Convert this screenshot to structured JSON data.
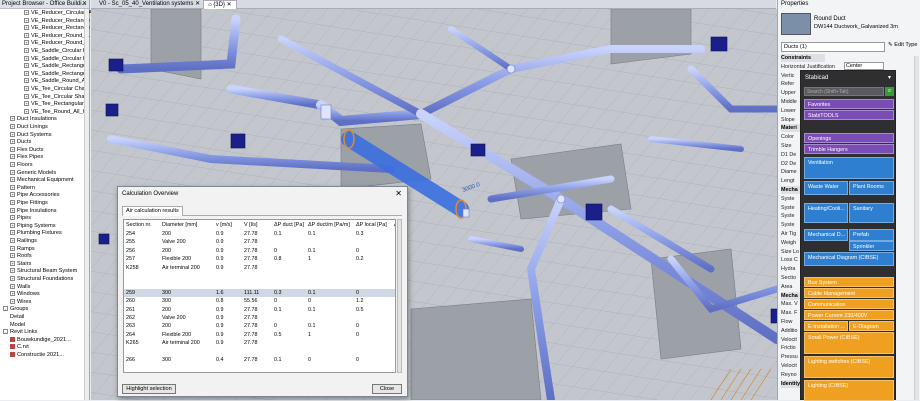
{
  "project_browser": {
    "title": "Project Browser - Office Buildi...",
    "items": [
      {
        "label": "VE_Reducer_Circular_A",
        "indent": 3,
        "toggle": "+"
      },
      {
        "label": "VE_Reducer_Rectangu",
        "indent": 3,
        "toggle": "+"
      },
      {
        "label": "VE_Reducer_Rectangu",
        "indent": 3,
        "toggle": "+"
      },
      {
        "label": "VE_Reducer_Round_...",
        "indent": 3,
        "toggle": "+"
      },
      {
        "label": "VE_Reducer_Round_",
        "indent": 3,
        "toggle": "+"
      },
      {
        "label": "VE_Saddle_Circular F",
        "indent": 3,
        "toggle": "+"
      },
      {
        "label": "VE_Saddle_Circular F",
        "indent": 3,
        "toggle": "+"
      },
      {
        "label": "VE_Saddle_Rectangu",
        "indent": 3,
        "toggle": "+"
      },
      {
        "label": "VE_Saddle_Rectangu",
        "indent": 3,
        "toggle": "+"
      },
      {
        "label": "VE_Saddle_Round_A",
        "indent": 3,
        "toggle": "+"
      },
      {
        "label": "VE_Tee_Circular Char",
        "indent": 3,
        "toggle": "+"
      },
      {
        "label": "VE_Tee_Circular Shar",
        "indent": 3,
        "toggle": "+"
      },
      {
        "label": "VE_Tee_Rectangular_",
        "indent": 3,
        "toggle": "+"
      },
      {
        "label": "VE_Tee_Round_All_G",
        "indent": 3,
        "toggle": "+"
      },
      {
        "label": "Duct Insulations",
        "indent": 1,
        "toggle": "+"
      },
      {
        "label": "Duct Linings",
        "indent": 1,
        "toggle": "+"
      },
      {
        "label": "Duct Systems",
        "indent": 1,
        "toggle": "+"
      },
      {
        "label": "Ducts",
        "indent": 1,
        "toggle": "+"
      },
      {
        "label": "Flex Ducts",
        "indent": 1,
        "toggle": "+"
      },
      {
        "label": "Flex Pipes",
        "indent": 1,
        "toggle": "+"
      },
      {
        "label": "Floors",
        "indent": 1,
        "toggle": "+"
      },
      {
        "label": "Generic Models",
        "indent": 1,
        "toggle": "+"
      },
      {
        "label": "Mechanical Equipment",
        "indent": 1,
        "toggle": "+"
      },
      {
        "label": "Pattern",
        "indent": 1,
        "toggle": "+"
      },
      {
        "label": "Pipe Accessories",
        "indent": 1,
        "toggle": "+"
      },
      {
        "label": "Pipe Fittings",
        "indent": 1,
        "toggle": "+"
      },
      {
        "label": "Pipe Insulations",
        "indent": 1,
        "toggle": "+"
      },
      {
        "label": "Pipes",
        "indent": 1,
        "toggle": "+"
      },
      {
        "label": "Piping Systems",
        "indent": 1,
        "toggle": "+"
      },
      {
        "label": "Plumbing Fixtures",
        "indent": 1,
        "toggle": "+"
      },
      {
        "label": "Railings",
        "indent": 1,
        "toggle": "+"
      },
      {
        "label": "Ramps",
        "indent": 1,
        "toggle": "+"
      },
      {
        "label": "Roofs",
        "indent": 1,
        "toggle": "+"
      },
      {
        "label": "Stairs",
        "indent": 1,
        "toggle": "+"
      },
      {
        "label": "Structural Beam System",
        "indent": 1,
        "toggle": "+"
      },
      {
        "label": "Structural Foundations",
        "indent": 1,
        "toggle": "+"
      },
      {
        "label": "Walls",
        "indent": 1,
        "toggle": "+"
      },
      {
        "label": "Windows",
        "indent": 1,
        "toggle": "+"
      },
      {
        "label": "Wires",
        "indent": 1,
        "toggle": "+"
      },
      {
        "label": "Groups",
        "indent": 0,
        "toggle": "-"
      },
      {
        "label": "Detail",
        "indent": 1,
        "toggle": ""
      },
      {
        "label": "Model",
        "indent": 1,
        "toggle": ""
      },
      {
        "label": "Revit Links",
        "indent": 0,
        "toggle": "-"
      },
      {
        "label": "Bouwkundige_2021...",
        "indent": 1,
        "toggle": "",
        "icon": true
      },
      {
        "label": "C.rvt",
        "indent": 1,
        "toggle": "",
        "icon": true
      },
      {
        "label": "Constructie 2021...",
        "indent": 1,
        "toggle": "",
        "icon": true
      }
    ]
  },
  "tabs": [
    {
      "label": "V0 - Sc_05_40_Ventilation systems",
      "active": false
    },
    {
      "label": "{3D}",
      "active": true
    }
  ],
  "viewport": {
    "duct_label": "3000.0",
    "colors": {
      "duct": "#8c9ee6",
      "duct_selected": "#3b6fe0",
      "equipment": "#1b1f8a",
      "grid": "#b7bcc4",
      "wall": "#9ea3aa"
    }
  },
  "properties": {
    "title": "Properties",
    "family": "Round Duct",
    "type": "DW144 Ductwork_Galvanized 3m",
    "selector": "Ducts (1)",
    "edit_type": "Edit Type",
    "rows": [
      {
        "label": "Constraints",
        "section": true
      },
      {
        "label": "Horizontal Justification",
        "value": "Center"
      },
      {
        "label": "Vertic"
      },
      {
        "label": "Refer"
      },
      {
        "label": "Upper"
      },
      {
        "label": "Middle"
      },
      {
        "label": "Lower"
      },
      {
        "label": "Slope"
      },
      {
        "label": "Materi",
        "section": true
      },
      {
        "label": "Color"
      },
      {
        "label": "Size"
      },
      {
        "label": "D1 De"
      },
      {
        "label": "D2 De"
      },
      {
        "label": "Diame"
      },
      {
        "label": "Lengt"
      },
      {
        "label": "Mecha",
        "section": true
      },
      {
        "label": "Syste"
      },
      {
        "label": "Syste"
      },
      {
        "label": "Syste"
      },
      {
        "label": "Syste"
      },
      {
        "label": "Air Tig"
      },
      {
        "label": "Weigh"
      },
      {
        "label": "Size Lo"
      },
      {
        "label": "Loss C"
      },
      {
        "label": "Hydra"
      },
      {
        "label": "Sectio"
      },
      {
        "label": "Area"
      },
      {
        "label": "Mecha",
        "section": true
      },
      {
        "label": "Max. V"
      },
      {
        "label": "Max. F"
      },
      {
        "label": "Flow"
      },
      {
        "label": "Additio"
      },
      {
        "label": "Velocit"
      },
      {
        "label": "Frictio"
      },
      {
        "label": "Pressu"
      },
      {
        "label": "Velocit"
      },
      {
        "label": "Reyno"
      },
      {
        "label": "Identity",
        "section": true
      }
    ]
  },
  "stabicad": {
    "title": "Stabicad",
    "search_placeholder": "Search (Shift+Tab)",
    "buttons": [
      {
        "label": "Favorites",
        "color": "#7a4db5"
      },
      {
        "label": "StabiTOOLS",
        "color": "#7a4db5"
      },
      {
        "label": "Openings",
        "color": "#7a4db5"
      },
      {
        "label": "Trimble Hangers",
        "color": "#7a4db5"
      },
      {
        "label": "Ventilation",
        "color": "#2f7fd0"
      },
      {
        "label": "Waste Water",
        "color": "#2f7fd0"
      },
      {
        "label": "Plant Rooms",
        "color": "#2f7fd0"
      },
      {
        "label": "Heating/Cooli...",
        "color": "#2f7fd0"
      },
      {
        "label": "Sanitary",
        "color": "#2f7fd0"
      },
      {
        "label": "Mechanical D...",
        "color": "#2f7fd0"
      },
      {
        "label": "Prefab",
        "color": "#2f7fd0"
      },
      {
        "label": "Sprinkler",
        "color": "#2f7fd0"
      },
      {
        "label": "Mechanical Diagram (CIBSE)",
        "color": "#2f7fd0"
      },
      {
        "label": "Bus System",
        "color": "#f0a020"
      },
      {
        "label": "Cable Management",
        "color": "#f0a020"
      },
      {
        "label": "Communication",
        "color": "#f0a020"
      },
      {
        "label": "Power Current 230/400V",
        "color": "#f0a020"
      },
      {
        "label": "E-Installation ...",
        "color": "#f0a020"
      },
      {
        "label": "E-Diagram",
        "color": "#f0a020"
      },
      {
        "label": "Small Power (CIBSE)",
        "color": "#f0a020"
      },
      {
        "label": "Lighting switches (CIBSE)",
        "color": "#f0a020"
      },
      {
        "label": "Lighting (CIBSE)",
        "color": "#f0a020"
      }
    ]
  },
  "dialog": {
    "title": "Calculation Overview",
    "tab": "Air calculation results",
    "headers": [
      "Section nr.",
      "Diameter [mm]",
      "v [m/s]",
      "V [l/s]",
      "ΔP duct [Pa]",
      "ΔP duct/m [Pa/m]",
      "ΔP local [Pa]",
      "ΔP"
    ],
    "rows": [
      [
        "254",
        "200",
        "0.9",
        "27.78",
        "0.1",
        "0.1",
        "0.3",
        ""
      ],
      [
        "255",
        "Valve 200",
        "0.9",
        "27.78",
        "",
        "",
        "",
        ""
      ],
      [
        "256",
        "200",
        "0.9",
        "27.78",
        "0",
        "0.1",
        "0",
        ""
      ],
      [
        "257",
        "Flexible 200",
        "0.9",
        "27.78",
        "0.8",
        "1",
        "0.2",
        ""
      ],
      [
        "K258",
        "Air terminal 200",
        "0.9",
        "27.78",
        "",
        "",
        "",
        ""
      ],
      [
        "",
        "",
        "",
        "",
        "",
        "",
        "",
        ""
      ],
      [
        "",
        "",
        "",
        "",
        "",
        "",
        "",
        ""
      ],
      [
        "259",
        "300",
        "1.6",
        "111.11",
        "0.3",
        "0.1",
        "0",
        ""
      ],
      [
        "260",
        "300",
        "0.8",
        "55.56",
        "0",
        "0",
        "1.2",
        ""
      ],
      [
        "261",
        "200",
        "0.9",
        "27.78",
        "0.1",
        "0.1",
        "0.5",
        ""
      ],
      [
        "262",
        "Valve 200",
        "0.9",
        "27.78",
        "",
        "",
        "",
        ""
      ],
      [
        "263",
        "200",
        "0.9",
        "27.78",
        "0",
        "0.1",
        "0",
        ""
      ],
      [
        "264",
        "Flexible 200",
        "0.9",
        "27.78",
        "0.5",
        "1",
        "0",
        ""
      ],
      [
        "K265",
        "Air terminal 200",
        "0.9",
        "27.78",
        "",
        "",
        "",
        ""
      ],
      [
        "",
        "",
        "",
        "",
        "",
        "",
        "",
        ""
      ],
      [
        "266",
        "300",
        "0.4",
        "27.78",
        "0.1",
        "0",
        "0",
        ""
      ]
    ],
    "selected_row": 7,
    "highlight_button": "Highlight selection",
    "close_button": "Close"
  }
}
